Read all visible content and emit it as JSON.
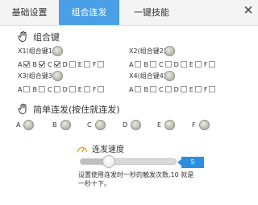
{
  "tabs": [
    {
      "label": "基础设置"
    },
    {
      "label": "组合连发"
    },
    {
      "label": "一键技能"
    }
  ],
  "close_symbol": "×",
  "combo_section": {
    "title": "组合键"
  },
  "combo_groups": [
    {
      "name": "X1(组合键1)",
      "keys": [
        {
          "label": "A",
          "checked": true
        },
        {
          "label": "B",
          "checked": true
        },
        {
          "label": "C",
          "checked": true
        },
        {
          "label": "D",
          "checked": false
        },
        {
          "label": "E",
          "checked": false
        },
        {
          "label": "F",
          "checked": false
        }
      ]
    },
    {
      "name": "X2(组合键2)",
      "keys": [
        {
          "label": "A",
          "checked": false
        },
        {
          "label": "B",
          "checked": false
        },
        {
          "label": "C",
          "checked": false
        },
        {
          "label": "D",
          "checked": false
        },
        {
          "label": "E",
          "checked": false
        },
        {
          "label": "F",
          "checked": false
        }
      ]
    },
    {
      "name": "X3(组合键3)",
      "keys": [
        {
          "label": "A",
          "checked": false
        },
        {
          "label": "B",
          "checked": false
        },
        {
          "label": "C",
          "checked": false
        },
        {
          "label": "D",
          "checked": false
        },
        {
          "label": "E",
          "checked": false
        },
        {
          "label": "F",
          "checked": false
        }
      ]
    },
    {
      "name": "X4(组合键4)",
      "keys": [
        {
          "label": "A",
          "checked": false
        },
        {
          "label": "B",
          "checked": false
        },
        {
          "label": "C",
          "checked": false
        },
        {
          "label": "D",
          "checked": false
        },
        {
          "label": "E",
          "checked": false
        },
        {
          "label": "F",
          "checked": false
        }
      ]
    }
  ],
  "simple_section": {
    "title": "简单连发(按住就连发)"
  },
  "simple_keys": [
    "A",
    "B",
    "C",
    "D",
    "E",
    "F"
  ],
  "speed": {
    "title": "连发速度",
    "value": "5",
    "level": 0.3,
    "description": "设置使用连发时一秒的触发次数,10 就是一秒十下。"
  },
  "colors": {
    "accent": "#4aa0e6",
    "value_badge": "#2f8de0"
  },
  "icons": {
    "section": "hand-icon",
    "speed": "gauge-icon",
    "close": "close-icon"
  }
}
